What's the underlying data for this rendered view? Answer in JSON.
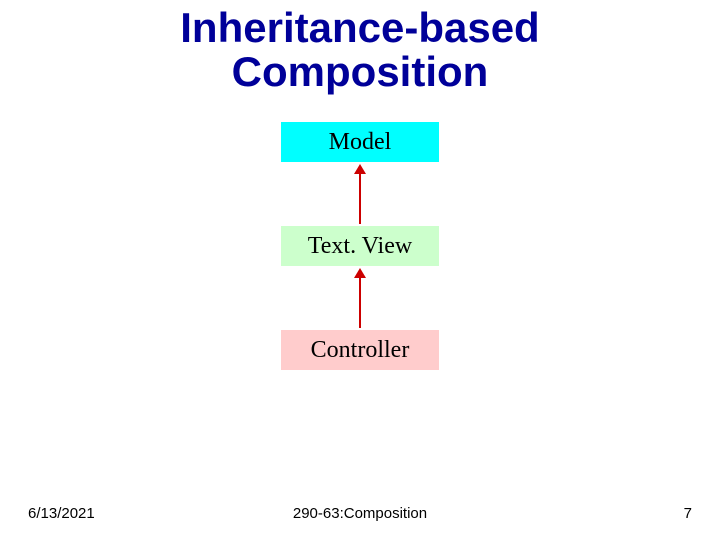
{
  "title_line1": "Inheritance-based",
  "title_line2": "Composition",
  "boxes": {
    "model": "Model",
    "textview": "Text. View",
    "controller": "Controller"
  },
  "footer": {
    "date": "6/13/2021",
    "center": "290-63:Composition",
    "page": "7"
  }
}
